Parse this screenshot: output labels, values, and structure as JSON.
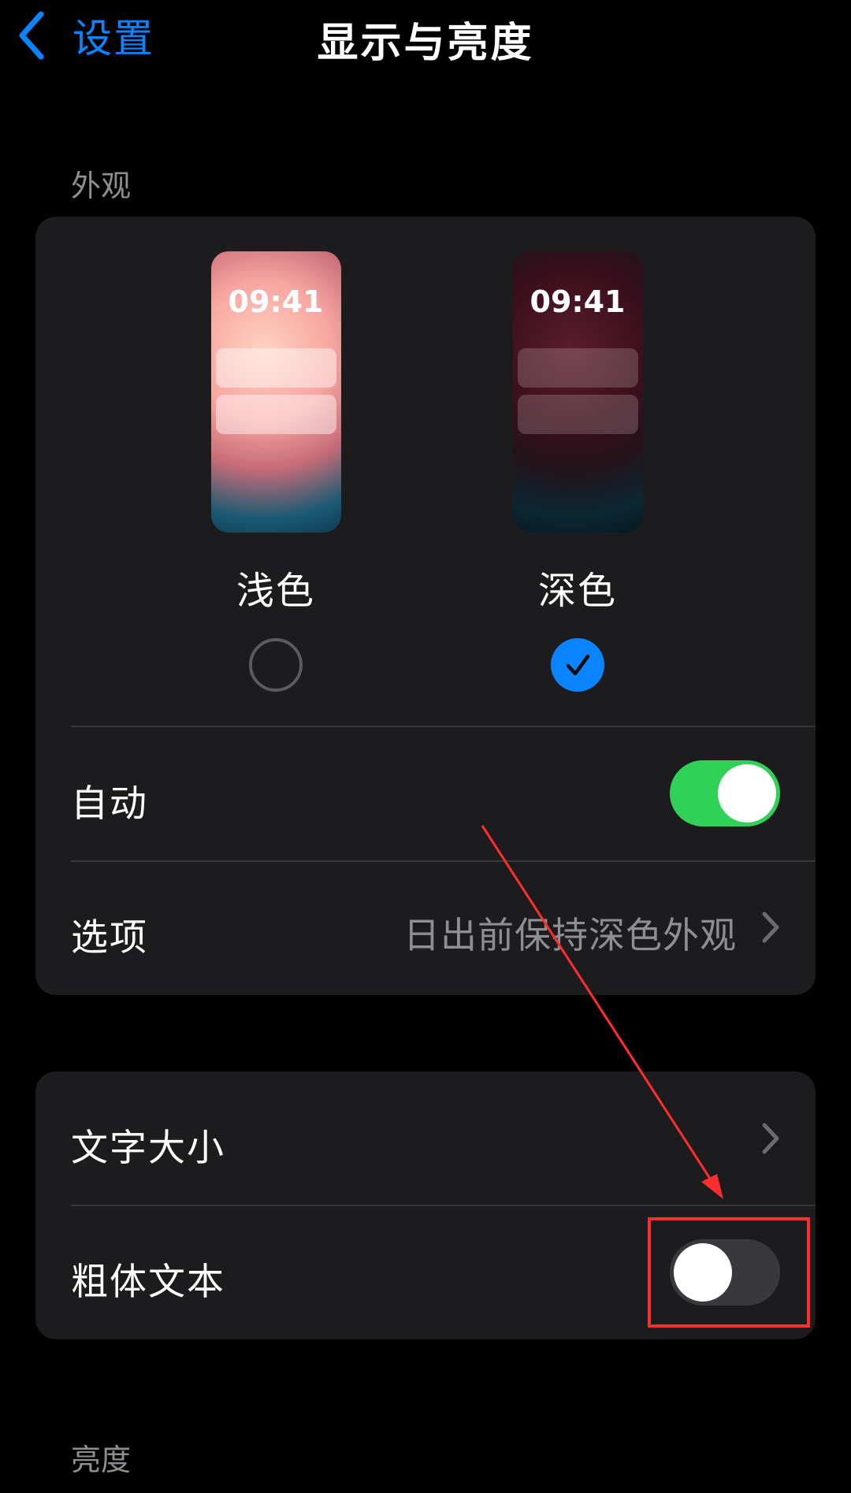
{
  "nav": {
    "back_label": "设置",
    "title": "显示与亮度"
  },
  "appearance": {
    "header": "外观",
    "light": {
      "label": "浅色",
      "time": "09:41",
      "selected": false
    },
    "dark": {
      "label": "深色",
      "time": "09:41",
      "selected": true
    },
    "auto": {
      "label": "自动",
      "on": true
    },
    "options": {
      "label": "选项",
      "value": "日出前保持深色外观"
    }
  },
  "text": {
    "text_size": {
      "label": "文字大小"
    },
    "bold_text": {
      "label": "粗体文本",
      "on": false
    }
  },
  "brightness": {
    "header": "亮度"
  },
  "colors": {
    "accent": "#0a84ff",
    "toggle_on": "#30d158",
    "annotation": "#ff2d2d"
  }
}
